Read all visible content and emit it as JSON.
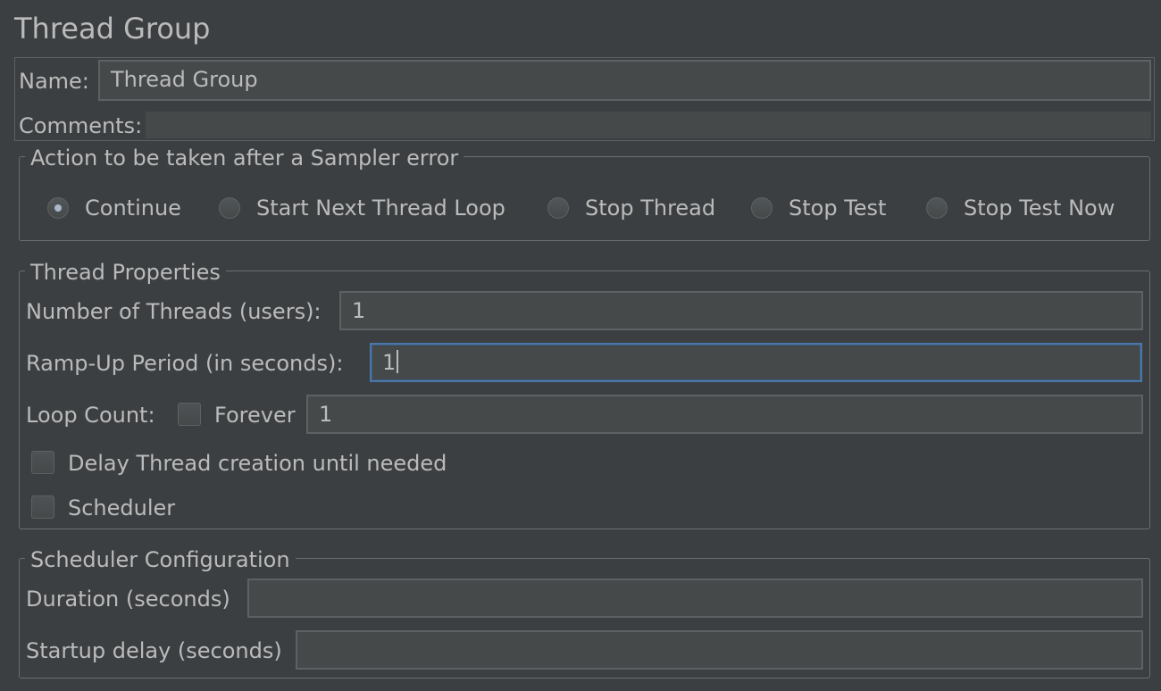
{
  "title": "Thread Group",
  "name_row": {
    "label": "Name:",
    "value": "Thread Group"
  },
  "comments_row": {
    "label": "Comments:",
    "value": ""
  },
  "sampler_error": {
    "legend": "Action to be taken after a Sampler error",
    "selected": "Continue",
    "options": [
      {
        "label": "Continue",
        "checked": true
      },
      {
        "label": "Start Next Thread Loop",
        "checked": false
      },
      {
        "label": "Stop Thread",
        "checked": false
      },
      {
        "label": "Stop Test",
        "checked": false
      },
      {
        "label": "Stop Test Now",
        "checked": false
      }
    ]
  },
  "thread_properties": {
    "legend": "Thread Properties",
    "num_threads": {
      "label": "Number of Threads (users):",
      "value": "1"
    },
    "ramp_up": {
      "label": "Ramp-Up Period (in seconds):",
      "value": "1"
    },
    "loop_count": {
      "label": "Loop Count:",
      "forever_label": "Forever",
      "forever_checked": false,
      "value": "1"
    },
    "delay_thread": {
      "label": "Delay Thread creation until needed",
      "checked": false
    },
    "scheduler": {
      "label": "Scheduler",
      "checked": false
    }
  },
  "scheduler_config": {
    "legend": "Scheduler Configuration",
    "duration": {
      "label": "Duration (seconds)",
      "value": ""
    },
    "startup_delay": {
      "label": "Startup delay (seconds)",
      "value": ""
    }
  },
  "colors": {
    "background": "#3c3f41",
    "field": "#45494a",
    "focus_border": "#4a77a7",
    "text": "#bbbbbb"
  }
}
